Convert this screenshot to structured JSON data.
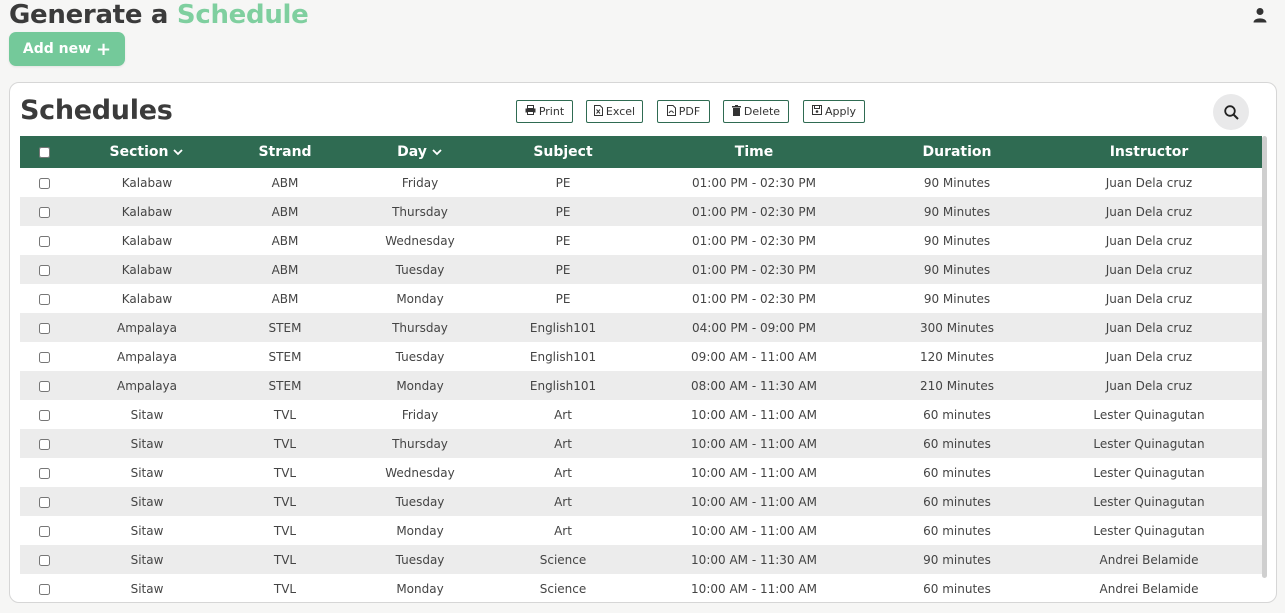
{
  "header": {
    "title_part1": "Generate a",
    "title_part2": "Schedule"
  },
  "add_button": {
    "label": "Add new"
  },
  "card": {
    "title": "Schedules",
    "toolbar": {
      "print": "Print",
      "excel": "Excel",
      "pdf": "PDF",
      "delete": "Delete",
      "apply": "Apply"
    }
  },
  "table": {
    "columns": {
      "section": "Section",
      "strand": "Strand",
      "day": "Day",
      "subject": "Subject",
      "time": "Time",
      "duration": "Duration",
      "instructor": "Instructor"
    },
    "rows": [
      {
        "section": "Kalabaw",
        "strand": "ABM",
        "day": "Friday",
        "subject": "PE",
        "time": "01:00 PM - 02:30 PM",
        "duration": "90 Minutes",
        "instructor": "Juan Dela cruz"
      },
      {
        "section": "Kalabaw",
        "strand": "ABM",
        "day": "Thursday",
        "subject": "PE",
        "time": "01:00 PM - 02:30 PM",
        "duration": "90 Minutes",
        "instructor": "Juan Dela cruz"
      },
      {
        "section": "Kalabaw",
        "strand": "ABM",
        "day": "Wednesday",
        "subject": "PE",
        "time": "01:00 PM - 02:30 PM",
        "duration": "90 Minutes",
        "instructor": "Juan Dela cruz"
      },
      {
        "section": "Kalabaw",
        "strand": "ABM",
        "day": "Tuesday",
        "subject": "PE",
        "time": "01:00 PM - 02:30 PM",
        "duration": "90 Minutes",
        "instructor": "Juan Dela cruz"
      },
      {
        "section": "Kalabaw",
        "strand": "ABM",
        "day": "Monday",
        "subject": "PE",
        "time": "01:00 PM - 02:30 PM",
        "duration": "90 Minutes",
        "instructor": "Juan Dela cruz"
      },
      {
        "section": "Ampalaya",
        "strand": "STEM",
        "day": "Thursday",
        "subject": "English101",
        "time": "04:00 PM - 09:00 PM",
        "duration": "300 Minutes",
        "instructor": "Juan Dela cruz"
      },
      {
        "section": "Ampalaya",
        "strand": "STEM",
        "day": "Tuesday",
        "subject": "English101",
        "time": "09:00 AM - 11:00 AM",
        "duration": "120 Minutes",
        "instructor": "Juan Dela cruz"
      },
      {
        "section": "Ampalaya",
        "strand": "STEM",
        "day": "Monday",
        "subject": "English101",
        "time": "08:00 AM - 11:30 AM",
        "duration": "210 Minutes",
        "instructor": "Juan Dela cruz"
      },
      {
        "section": "Sitaw",
        "strand": "TVL",
        "day": "Friday",
        "subject": "Art",
        "time": "10:00 AM - 11:00 AM",
        "duration": "60 minutes",
        "instructor": "Lester Quinagutan"
      },
      {
        "section": "Sitaw",
        "strand": "TVL",
        "day": "Thursday",
        "subject": "Art",
        "time": "10:00 AM - 11:00 AM",
        "duration": "60 minutes",
        "instructor": "Lester Quinagutan"
      },
      {
        "section": "Sitaw",
        "strand": "TVL",
        "day": "Wednesday",
        "subject": "Art",
        "time": "10:00 AM - 11:00 AM",
        "duration": "60 minutes",
        "instructor": "Lester Quinagutan"
      },
      {
        "section": "Sitaw",
        "strand": "TVL",
        "day": "Tuesday",
        "subject": "Art",
        "time": "10:00 AM - 11:00 AM",
        "duration": "60 minutes",
        "instructor": "Lester Quinagutan"
      },
      {
        "section": "Sitaw",
        "strand": "TVL",
        "day": "Monday",
        "subject": "Art",
        "time": "10:00 AM - 11:00 AM",
        "duration": "60 minutes",
        "instructor": "Lester Quinagutan"
      },
      {
        "section": "Sitaw",
        "strand": "TVL",
        "day": "Tuesday",
        "subject": "Science",
        "time": "10:00 AM - 11:30 AM",
        "duration": "90 minutes",
        "instructor": "Andrei Belamide"
      },
      {
        "section": "Sitaw",
        "strand": "TVL",
        "day": "Monday",
        "subject": "Science",
        "time": "10:00 AM - 11:00 AM",
        "duration": "60 minutes",
        "instructor": "Andrei Belamide"
      }
    ]
  },
  "icons": {
    "user": "user-icon",
    "plus": "plus-icon",
    "print": "print-icon",
    "excel": "excel-icon",
    "pdf": "pdf-icon",
    "delete": "trash-icon",
    "apply": "save-icon",
    "search": "search-icon",
    "sort": "chevron-down-icon"
  },
  "colors": {
    "accent": "#7fcf9f",
    "button": "#74c99a",
    "header": "#2f6b52",
    "row_alt": "#ececec"
  }
}
